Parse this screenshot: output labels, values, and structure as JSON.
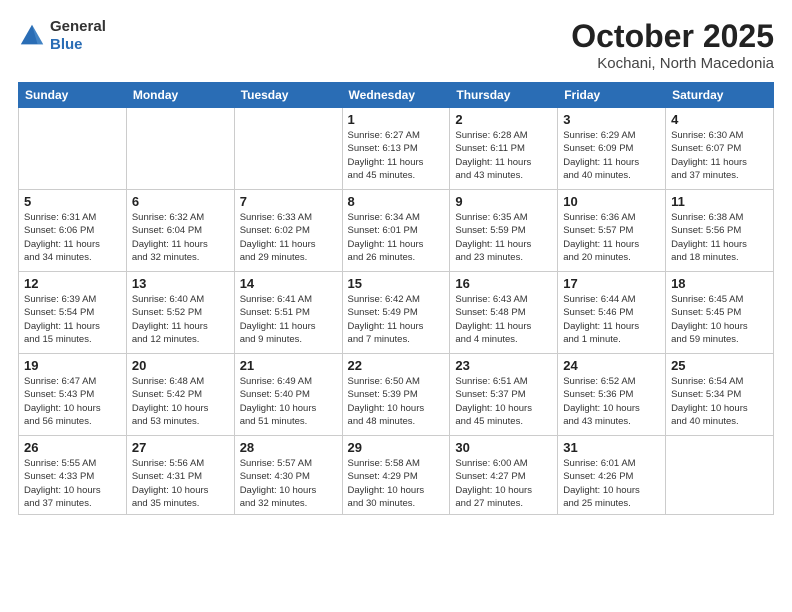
{
  "header": {
    "logo_general": "General",
    "logo_blue": "Blue",
    "month_title": "October 2025",
    "location": "Kochani, North Macedonia"
  },
  "weekdays": [
    "Sunday",
    "Monday",
    "Tuesday",
    "Wednesday",
    "Thursday",
    "Friday",
    "Saturday"
  ],
  "weeks": [
    [
      {
        "day": "",
        "info": "",
        "empty": true
      },
      {
        "day": "",
        "info": "",
        "empty": true
      },
      {
        "day": "",
        "info": "",
        "empty": true
      },
      {
        "day": "1",
        "info": "Sunrise: 6:27 AM\nSunset: 6:13 PM\nDaylight: 11 hours\nand 45 minutes."
      },
      {
        "day": "2",
        "info": "Sunrise: 6:28 AM\nSunset: 6:11 PM\nDaylight: 11 hours\nand 43 minutes."
      },
      {
        "day": "3",
        "info": "Sunrise: 6:29 AM\nSunset: 6:09 PM\nDaylight: 11 hours\nand 40 minutes."
      },
      {
        "day": "4",
        "info": "Sunrise: 6:30 AM\nSunset: 6:07 PM\nDaylight: 11 hours\nand 37 minutes."
      }
    ],
    [
      {
        "day": "5",
        "info": "Sunrise: 6:31 AM\nSunset: 6:06 PM\nDaylight: 11 hours\nand 34 minutes."
      },
      {
        "day": "6",
        "info": "Sunrise: 6:32 AM\nSunset: 6:04 PM\nDaylight: 11 hours\nand 32 minutes."
      },
      {
        "day": "7",
        "info": "Sunrise: 6:33 AM\nSunset: 6:02 PM\nDaylight: 11 hours\nand 29 minutes."
      },
      {
        "day": "8",
        "info": "Sunrise: 6:34 AM\nSunset: 6:01 PM\nDaylight: 11 hours\nand 26 minutes."
      },
      {
        "day": "9",
        "info": "Sunrise: 6:35 AM\nSunset: 5:59 PM\nDaylight: 11 hours\nand 23 minutes."
      },
      {
        "day": "10",
        "info": "Sunrise: 6:36 AM\nSunset: 5:57 PM\nDaylight: 11 hours\nand 20 minutes."
      },
      {
        "day": "11",
        "info": "Sunrise: 6:38 AM\nSunset: 5:56 PM\nDaylight: 11 hours\nand 18 minutes."
      }
    ],
    [
      {
        "day": "12",
        "info": "Sunrise: 6:39 AM\nSunset: 5:54 PM\nDaylight: 11 hours\nand 15 minutes."
      },
      {
        "day": "13",
        "info": "Sunrise: 6:40 AM\nSunset: 5:52 PM\nDaylight: 11 hours\nand 12 minutes."
      },
      {
        "day": "14",
        "info": "Sunrise: 6:41 AM\nSunset: 5:51 PM\nDaylight: 11 hours\nand 9 minutes."
      },
      {
        "day": "15",
        "info": "Sunrise: 6:42 AM\nSunset: 5:49 PM\nDaylight: 11 hours\nand 7 minutes."
      },
      {
        "day": "16",
        "info": "Sunrise: 6:43 AM\nSunset: 5:48 PM\nDaylight: 11 hours\nand 4 minutes."
      },
      {
        "day": "17",
        "info": "Sunrise: 6:44 AM\nSunset: 5:46 PM\nDaylight: 11 hours\nand 1 minute."
      },
      {
        "day": "18",
        "info": "Sunrise: 6:45 AM\nSunset: 5:45 PM\nDaylight: 10 hours\nand 59 minutes."
      }
    ],
    [
      {
        "day": "19",
        "info": "Sunrise: 6:47 AM\nSunset: 5:43 PM\nDaylight: 10 hours\nand 56 minutes."
      },
      {
        "day": "20",
        "info": "Sunrise: 6:48 AM\nSunset: 5:42 PM\nDaylight: 10 hours\nand 53 minutes."
      },
      {
        "day": "21",
        "info": "Sunrise: 6:49 AM\nSunset: 5:40 PM\nDaylight: 10 hours\nand 51 minutes."
      },
      {
        "day": "22",
        "info": "Sunrise: 6:50 AM\nSunset: 5:39 PM\nDaylight: 10 hours\nand 48 minutes."
      },
      {
        "day": "23",
        "info": "Sunrise: 6:51 AM\nSunset: 5:37 PM\nDaylight: 10 hours\nand 45 minutes."
      },
      {
        "day": "24",
        "info": "Sunrise: 6:52 AM\nSunset: 5:36 PM\nDaylight: 10 hours\nand 43 minutes."
      },
      {
        "day": "25",
        "info": "Sunrise: 6:54 AM\nSunset: 5:34 PM\nDaylight: 10 hours\nand 40 minutes."
      }
    ],
    [
      {
        "day": "26",
        "info": "Sunrise: 5:55 AM\nSunset: 4:33 PM\nDaylight: 10 hours\nand 37 minutes."
      },
      {
        "day": "27",
        "info": "Sunrise: 5:56 AM\nSunset: 4:31 PM\nDaylight: 10 hours\nand 35 minutes."
      },
      {
        "day": "28",
        "info": "Sunrise: 5:57 AM\nSunset: 4:30 PM\nDaylight: 10 hours\nand 32 minutes."
      },
      {
        "day": "29",
        "info": "Sunrise: 5:58 AM\nSunset: 4:29 PM\nDaylight: 10 hours\nand 30 minutes."
      },
      {
        "day": "30",
        "info": "Sunrise: 6:00 AM\nSunset: 4:27 PM\nDaylight: 10 hours\nand 27 minutes."
      },
      {
        "day": "31",
        "info": "Sunrise: 6:01 AM\nSunset: 4:26 PM\nDaylight: 10 hours\nand 25 minutes."
      },
      {
        "day": "",
        "info": "",
        "empty": true
      }
    ]
  ]
}
